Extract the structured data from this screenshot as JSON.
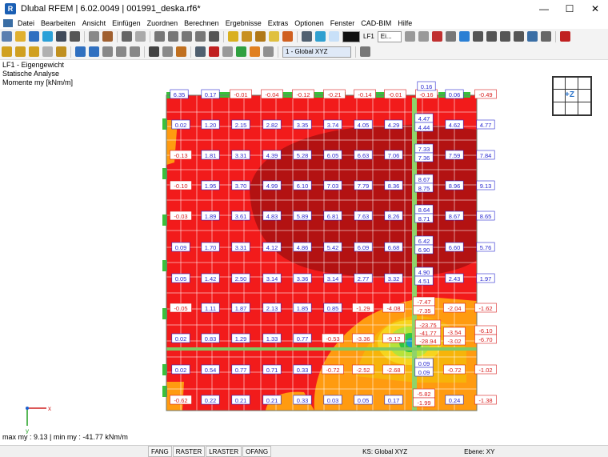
{
  "window": {
    "title": "Dlubal RFEM | 6.02.0049 | 001991_deska.rf6*",
    "min": "—",
    "max": "☐",
    "close": "✕"
  },
  "menu": [
    "Datei",
    "Bearbeiten",
    "Ansicht",
    "Einfügen",
    "Zuordnen",
    "Berechnen",
    "Ergebnisse",
    "Extras",
    "Optionen",
    "Fenster",
    "CAD-BIM",
    "Hilfe"
  ],
  "toolbar": {
    "loadcase_short": "LF1",
    "loadcase_combo": "Ei...",
    "coord_system": "1 - Global XYZ"
  },
  "info": {
    "line1": "LF1 - Eigengewicht",
    "line2": "Statische Analyse",
    "line3": "Momente my [kNm/m]"
  },
  "view_cube": {
    "label": "+Z"
  },
  "axes": {
    "x": "x",
    "y": "y"
  },
  "maxmin": "max my : 9.13 | min my : -41.77 kNm/m",
  "statusbar": {
    "cells": [
      "FANG",
      "RASTER",
      "LRASTER",
      "OFANG"
    ],
    "ks": "KS: Global XYZ",
    "ebene": "Ebene: XY"
  },
  "colors": {
    "plate_red": "#f21b1b",
    "dark_red": "#b31212",
    "orange": "#ff9b10",
    "amber": "#f7b40a",
    "green": "#30c540",
    "support_green": "#39c23a",
    "label_blue": "#2a2ad0",
    "label_red": "#d81e1e"
  },
  "results": {
    "top_row": [
      "6.35",
      "0.17",
      "-0.01",
      "-0.04",
      "-0.12",
      "-0.21",
      "-0.14",
      "-0.01",
      "-0.16",
      "0.06",
      "-0.49"
    ],
    "top_extra": "0.16",
    "grid": [
      [
        "0.02",
        "1.20",
        "2.15",
        "2.82",
        "3.35",
        "3.74",
        "4.05",
        "4.29",
        "4.47",
        "4.44",
        "4.62",
        "4.77"
      ],
      [
        "-0.13",
        "1.81",
        "3.31",
        "4.39",
        "5.28",
        "6.05",
        "6.63",
        "7.06",
        "7.33",
        "7.36",
        "7.59",
        "7.84"
      ],
      [
        "-0.10",
        "1.95",
        "3.70",
        "4.99",
        "6.10",
        "7.03",
        "7.79",
        "8.36",
        "8.67",
        "8.75",
        "8.96",
        "9.13"
      ],
      [
        "-0.03",
        "1.89",
        "3.61",
        "4.83",
        "5.89",
        "6.81",
        "7.63",
        "8.26",
        "8.64",
        "8.71",
        "8.67",
        "8.65"
      ],
      [
        "0.09",
        "1.70",
        "3.31",
        "4.12",
        "4.86",
        "5.42",
        "6.09",
        "6.68",
        "6.42",
        "6.90",
        "6.60",
        "5.76"
      ],
      [
        "0.05",
        "1.42",
        "2.50",
        "3.14",
        "3.36",
        "3.14",
        "2.77",
        "3.32",
        "4.90",
        "4.51",
        "2.43",
        "1.97"
      ],
      [
        "-0.05",
        "1.11",
        "1.87",
        "2.13",
        "1.85",
        "0.85",
        "-1.29",
        "-4.08",
        "-7.47",
        "-7.35",
        "-2.04",
        "-1.62"
      ],
      [
        "0.02",
        "0.83",
        "1.29",
        "1.33",
        "0.77",
        "-0.53",
        "-3.36",
        "-9.12",
        "-23.75",
        "-41.77",
        "-28.94",
        "-3.54",
        "-3.02",
        "-6.10",
        "-6.70"
      ],
      [
        "0.02",
        "0.54",
        "0.77",
        "0.71",
        "0.33",
        "-0.72",
        "-2.52",
        "-2.68",
        "0.09",
        "0.09",
        "-0.72",
        "-1.02"
      ],
      [
        "-0.62",
        "0.22",
        "0.21",
        "0.21",
        "0.33",
        "0.03",
        "0.05",
        "0.17",
        "-5.82",
        "-1.99",
        "0.24",
        "-1.38"
      ]
    ]
  }
}
